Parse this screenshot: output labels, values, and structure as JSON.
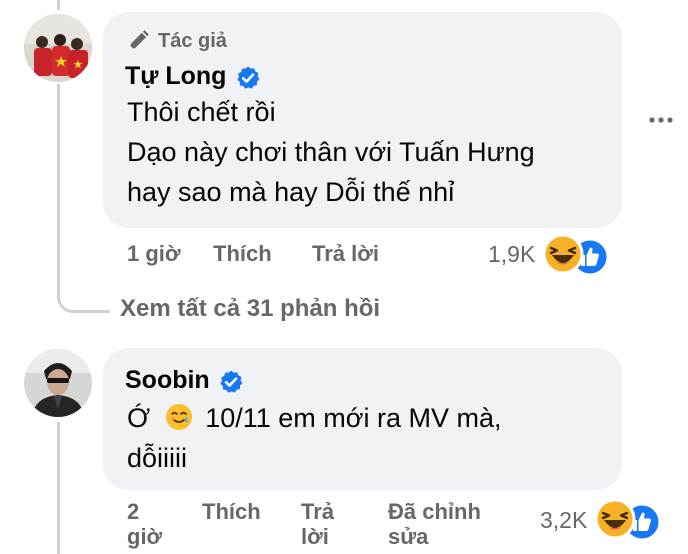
{
  "comment1": {
    "badge": "Tác giả",
    "author": "Tự Long",
    "lines": [
      "Thôi chết rồi",
      "Dạo này chơi thân với Tuấn Hưng",
      "hay sao mà hay Dỗi thế nhỉ"
    ],
    "time": "1 giờ",
    "like": "Thích",
    "reply": "Trả lời",
    "reactions": "1,9K",
    "reaction_icons": [
      "haha-icon",
      "like-icon"
    ]
  },
  "view_replies": "Xem tất cả 31 phản hồi",
  "comment2": {
    "author": "Soobin",
    "line1_start": "Ớ",
    "line1_emoji": "smiling-face-with-tear-icon",
    "line1_end": "10/11 em mới ra MV mà,",
    "line2": "dỗiiiii",
    "time_l1": "2",
    "time_l2": "giờ",
    "like": "Thích",
    "reply_l1": "Trả",
    "reply_l2": "lời",
    "edited_l1": "Đã chỉnh",
    "edited_l2": "sửa",
    "reactions": "3,2K",
    "reaction_icons": [
      "haha-icon",
      "like-icon"
    ]
  },
  "colors": {
    "bubble": "#f0f2f5",
    "secondary": "#65676b",
    "verified": "#1877f2",
    "haha": "#f7b125"
  }
}
